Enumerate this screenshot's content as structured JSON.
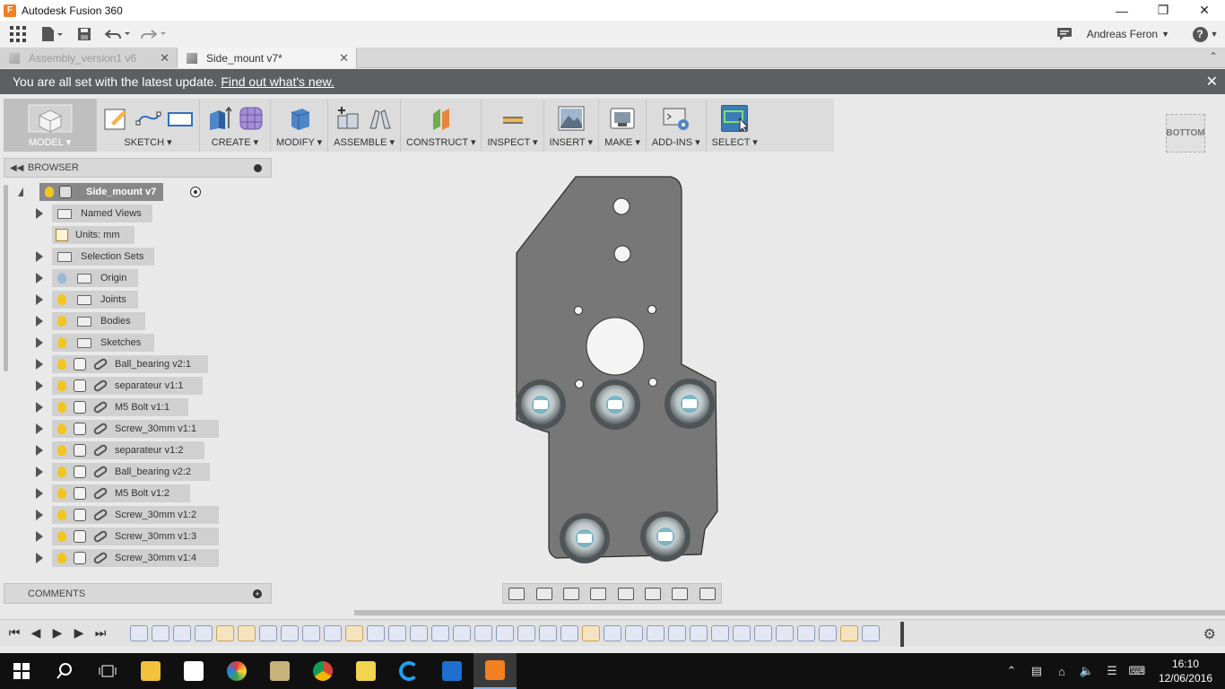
{
  "window": {
    "title": "Autodesk Fusion 360",
    "app_icon": "F"
  },
  "qat": {
    "user": "Andreas Feron",
    "help": "?"
  },
  "tabs": [
    {
      "label": "Assembly_version1 v6",
      "active": false
    },
    {
      "label": "Side_mount v7*",
      "active": true
    }
  ],
  "banner": {
    "message": "You are all set with the latest update.",
    "link": "Find out what's new."
  },
  "ribbon": {
    "workspace": "MODEL",
    "groups": [
      "SKETCH",
      "CREATE",
      "MODIFY",
      "ASSEMBLE",
      "CONSTRUCT",
      "INSPECT",
      "INSERT",
      "MAKE",
      "ADD-INS",
      "SELECT"
    ]
  },
  "viewcube": {
    "face": "BOTTOM"
  },
  "browser": {
    "title": "BROWSER",
    "root": "Side_mount v7",
    "items": [
      {
        "label": "Named Views",
        "kind": "folder"
      },
      {
        "label": "Units: mm",
        "kind": "units"
      },
      {
        "label": "Selection Sets",
        "kind": "folder"
      },
      {
        "label": "Origin",
        "kind": "folder"
      },
      {
        "label": "Joints",
        "kind": "folder"
      },
      {
        "label": "Bodies",
        "kind": "folder"
      },
      {
        "label": "Sketches",
        "kind": "folder"
      },
      {
        "label": "Ball_bearing v2:1",
        "kind": "component"
      },
      {
        "label": "separateur v1:1",
        "kind": "component"
      },
      {
        "label": "M5 Bolt v1:1",
        "kind": "component"
      },
      {
        "label": "Screw_30mm v1:1",
        "kind": "component"
      },
      {
        "label": "separateur v1:2",
        "kind": "component"
      },
      {
        "label": "Ball_bearing v2:2",
        "kind": "component"
      },
      {
        "label": "M5 Bolt v1:2",
        "kind": "component"
      },
      {
        "label": "Screw_30mm v1:2",
        "kind": "component"
      },
      {
        "label": "Screw_30mm v1:3",
        "kind": "component"
      },
      {
        "label": "Screw_30mm v1:4",
        "kind": "component"
      }
    ]
  },
  "comments": {
    "title": "COMMENTS"
  },
  "taskbar": {
    "time": "16:10",
    "date": "12/06/2016"
  },
  "colors": {
    "banner": "#5d6063",
    "select_active": "#3c7bb5",
    "plate": "#777777",
    "taskbar": "#101010"
  }
}
